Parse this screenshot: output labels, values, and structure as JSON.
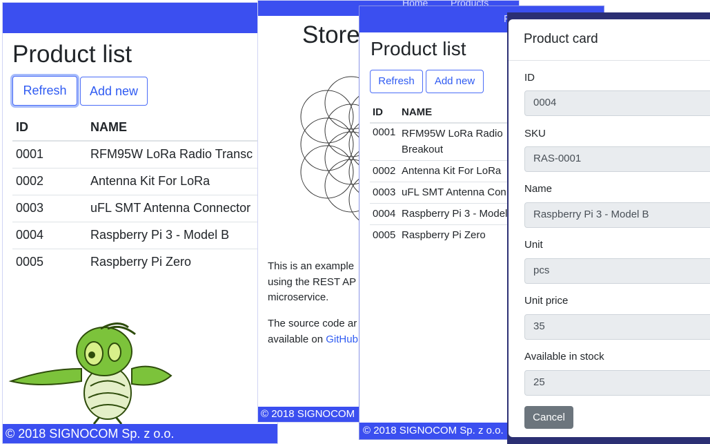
{
  "w1": {
    "title": "Product list",
    "refresh": "Refresh",
    "add_new": "Add new",
    "columns": [
      "ID",
      "NAME"
    ],
    "rows": [
      {
        "id": "0001",
        "name": "RFM95W LoRa Radio Transc"
      },
      {
        "id": "0002",
        "name": "Antenna Kit For LoRa"
      },
      {
        "id": "0003",
        "name": "uFL SMT Antenna Connector"
      },
      {
        "id": "0004",
        "name": "Raspberry Pi 3 - Model B"
      },
      {
        "id": "0005",
        "name": "Raspberry Pi Zero"
      }
    ],
    "footer": "© 2018 SIGNOCOM Sp. z o.o."
  },
  "w2": {
    "nav_home": "Home",
    "nav_products": "Products",
    "title": "Store",
    "p1a": "This is an example",
    "p1b": "using the REST AP",
    "p1c": "microservice.",
    "p2a": "The source code ar",
    "p2b": "available on",
    "github": "GitHub",
    "footer": "© 2018 SIGNOCOM"
  },
  "w3": {
    "nav_short": "P",
    "title": "Product list",
    "refresh": "Refresh",
    "add_new": "Add new",
    "columns": [
      "ID",
      "NAME"
    ],
    "rows": [
      {
        "id": "0001",
        "name1": "RFM95W LoRa Radio",
        "name2": "Breakout"
      },
      {
        "id": "0002",
        "name1": "Antenna Kit For LoRa",
        "name2": ""
      },
      {
        "id": "0003",
        "name1": "uFL SMT Antenna Con",
        "name2": ""
      },
      {
        "id": "0004",
        "name1": "Raspberry Pi 3 - Model",
        "name2": ""
      },
      {
        "id": "0005",
        "name1": "Raspberry Pi Zero",
        "name2": ""
      }
    ],
    "footer": "© 2018 SIGNOCOM Sp. z o.o."
  },
  "w4": {
    "title": "Product card",
    "fields": [
      {
        "label": "ID",
        "value": "0004"
      },
      {
        "label": "SKU",
        "value": "RAS-0001"
      },
      {
        "label": "Name",
        "value": "Raspberry Pi 3 - Model B"
      },
      {
        "label": "Unit",
        "value": "pcs"
      },
      {
        "label": "Unit price",
        "value": "35"
      },
      {
        "label": "Available in stock",
        "value": "25"
      }
    ],
    "cancel": "Cancel"
  },
  "colors": {
    "accent_blue": "#3b4ff0",
    "dark_frame": "#2b2f73",
    "button_grey": "#6c757d",
    "link_blue": "#2f5bf2"
  },
  "icons": [
    "cricket-mascot-illustration",
    "flower-of-life-logo"
  ]
}
